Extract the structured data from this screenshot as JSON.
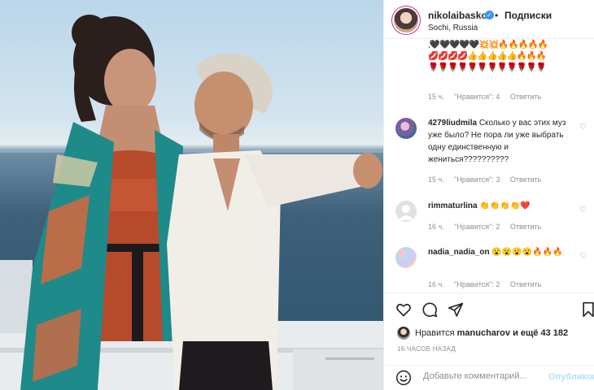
{
  "post": {
    "username": "nikolaibaskov",
    "follow_label": "Подписки",
    "location": "Sochi, Russia"
  },
  "comments": [
    {
      "emoji_lines": [
        ",🖤🖤🖤🖤🖤💥💥🔥🔥🔥🔥🔥",
        "💋💋💋💋👍👍👍👍👍🔥🔥🔥",
        "🌹🌹🌹🌹🌹🌹🌹🌹🌹🌹🌹🌹"
      ],
      "time": "15 ч.",
      "likes": "\"Нравится\": 4",
      "reply": "Ответить"
    },
    {
      "username": "4279liudmila",
      "text": "Сколько у вас этих муз уже было? Не пора ли уже выбрать одну единственную и жениться??????????",
      "time": "15 ч.",
      "likes": "\"Нравится\": 3",
      "reply": "Ответить"
    },
    {
      "username": "rimmaturlina",
      "text": "👏👏👏👏❤️",
      "time": "16 ч.",
      "likes": "\"Нравится\": 2",
      "reply": "Ответить"
    },
    {
      "username": "nadia_nadia_on",
      "text": "😮😮😮😮🔥🔥🔥",
      "time": "16 ч.",
      "likes": "\"Нравится\": 2",
      "reply": "Ответить"
    }
  ],
  "likes": {
    "prefix": "Нравится",
    "user": "manucharov",
    "suffix": "и ещё 43 182"
  },
  "posted_time": "16 ЧАСОВ НАЗАД",
  "add_comment": {
    "placeholder": "Добавьте комментарий...",
    "publish": "Опубликовать"
  },
  "icons": {
    "verified": "verified-badge-icon",
    "like": "heart-icon",
    "comment": "comment-icon",
    "share": "paper-plane-icon",
    "save": "bookmark-icon",
    "emoji": "smiley-icon"
  },
  "colors": {
    "verified": "#3897f0",
    "text": "#262626",
    "muted": "#8e8e8e",
    "publish": "#b2dffc",
    "border": "#efefef"
  }
}
